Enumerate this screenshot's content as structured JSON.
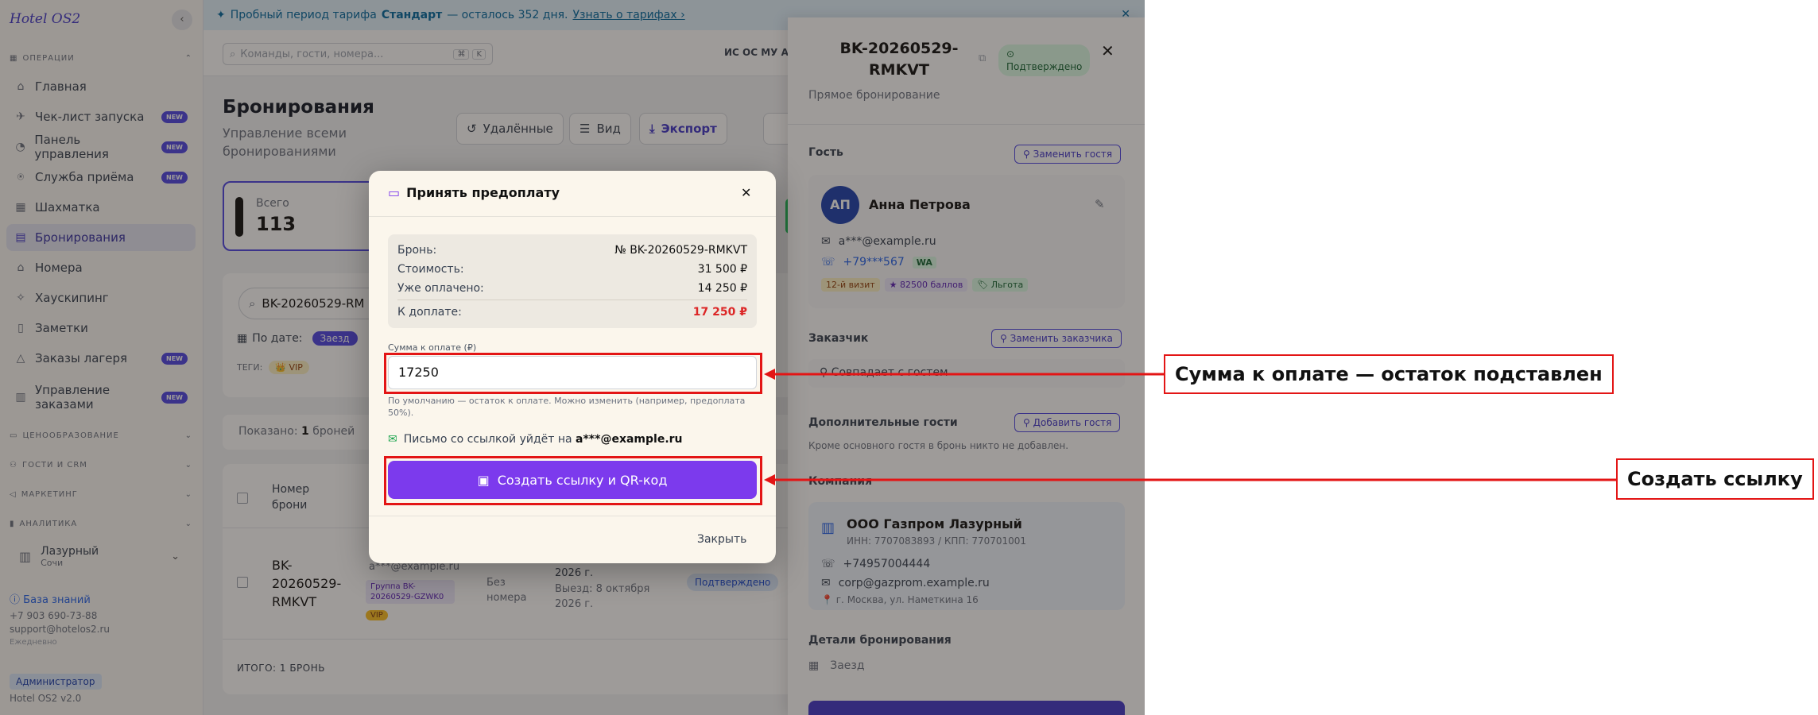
{
  "sidebar": {
    "logo": "Hotel OS2",
    "collapse_icon": "chevron-left-icon",
    "section_operations": "ОПЕРАЦИИ",
    "items": [
      {
        "label": "Главная",
        "icon": "home-icon",
        "new": false
      },
      {
        "label": "Чек-лист запуска",
        "icon": "rocket-icon",
        "new": true
      },
      {
        "label": "Панель управления",
        "icon": "dashboard-icon",
        "new": true
      },
      {
        "label": "Служба приёма",
        "icon": "reception-icon",
        "new": true
      },
      {
        "label": "Шахматка",
        "icon": "grid-icon",
        "new": false
      },
      {
        "label": "Бронирования",
        "icon": "clipboard-icon",
        "new": false,
        "active": true
      },
      {
        "label": "Номера",
        "icon": "door-icon",
        "new": false
      },
      {
        "label": "Хаускипинг",
        "icon": "broom-icon",
        "new": false
      },
      {
        "label": "Заметки",
        "icon": "note-icon",
        "new": false
      },
      {
        "label": "Заказы лагеря",
        "icon": "tent-icon",
        "new": true
      },
      {
        "label": "Управление заказами",
        "icon": "orders-icon",
        "new": true
      }
    ],
    "new_badge": "NEW",
    "section_pricing": "ЦЕНООБРАЗОВАНИЕ",
    "section_guests": "ГОСТИ И CRM",
    "section_marketing": "МАРКЕТИНГ",
    "section_analytics": "АНАЛИТИКА",
    "hotel_name": "Лазурный",
    "hotel_city": "Сочи",
    "kb_link": "База знаний",
    "phone": "+7 903 690-73-88",
    "email": "support@hotelos2.ru",
    "hours": "Ежедневно",
    "role": "Администратор",
    "version": "Hotel OS2 v2.0"
  },
  "banner": {
    "text_a": "Пробный период тарифа ",
    "plan": "Стандарт",
    "text_b": " — осталось 352 дня. ",
    "link": "Узнать о тарифах ›",
    "close": "✕"
  },
  "topbar": {
    "search_placeholder": "Команды, гости, номера...",
    "kbd_a": "⌘",
    "kbd_b": "K",
    "users": "ИС ОС МУ АК"
  },
  "main": {
    "title": "Бронирования",
    "subtitle": "Управление всеми бронированиями",
    "btn_deleted": "Удалённые",
    "btn_view": "Вид",
    "btn_export": "Экспорт",
    "stat_label": "Всего",
    "stat_value": "113",
    "search_value": "BK-20260529-RM",
    "date_label": "По дате:",
    "date_chip": "Заезд",
    "tags_label": "ТЕГИ:",
    "tag_vip": "VIP",
    "shown_a": "Показано: ",
    "shown_n": "1",
    "shown_b": " броней",
    "col_booking": "Номер брони",
    "row_booking": "BK-20260529-RMKVT",
    "row_email": "a***@example.ru",
    "row_group": "Группа BK-20260529-GZWK0",
    "row_room": "Без номера",
    "row_year": "2026 г.",
    "row_checkout": "Выезд: 8 октября 2026 г.",
    "row_status": "Подтверждено",
    "total": "ИТОГО: 1 БРОНЬ"
  },
  "drawer": {
    "booking_id": "BK-20260529-RMKVT",
    "status": "Подтверждено",
    "source": "Прямое бронирование",
    "guest_heading": "Гость",
    "replace_guest": "Заменить гостя",
    "avatar": "АП",
    "guest_name": "Анна Петрова",
    "guest_email": "a***@example.ru",
    "guest_phone": "+79***567",
    "wa": "WA",
    "tag_visit": "12-й визит",
    "tag_points": "★ 82500 баллов",
    "tag_benefit": "🏷 Льгота",
    "customer_heading": "Заказчик",
    "replace_customer": "Заменить заказчика",
    "customer_same": "Совпадает с гостем",
    "extra_heading": "Дополнительные гости",
    "add_guest": "Добавить гостя",
    "extra_note": "Кроме основного гостя в бронь никто не добавлен.",
    "company_heading": "Компания",
    "company_name": "ООО Газпром Лазурный",
    "company_inn": "ИНН: 7707083893 / КПП: 770701001",
    "company_phone": "+74957004444",
    "company_email": "corp@gazprom.example.ru",
    "company_addr": "📍 г. Москва, ул. Наметкина 16",
    "details_heading": "Детали бронирования",
    "checkin_label": "Заезд"
  },
  "modal": {
    "title": "Принять предоплату",
    "title_icon": "credit-card-icon",
    "rows": [
      {
        "label": "Бронь:",
        "value": "№ BK-20260529-RMKVT"
      },
      {
        "label": "Стоимость:",
        "value": "31 500 ₽"
      },
      {
        "label": "Уже оплачено:",
        "value": "14 250 ₽"
      }
    ],
    "due_label": "К доплате:",
    "due_value": "17 250 ₽",
    "amount_label": "Сумма к оплате (₽)",
    "amount_value": "17250",
    "hint": "По умолчанию — остаток к оплате. Можно изменить (например, предоплата 50%).",
    "email_note": "Письмо со ссылкой уйдёт на ",
    "email_addr": "a***@example.ru",
    "create_button": "Создать ссылку и QR-код",
    "close_button": "Закрыть"
  },
  "annotations": {
    "callout_amount": "Сумма к оплате — остаток подставлен",
    "callout_create": "Создать ссылку",
    "color": "#e31515"
  }
}
